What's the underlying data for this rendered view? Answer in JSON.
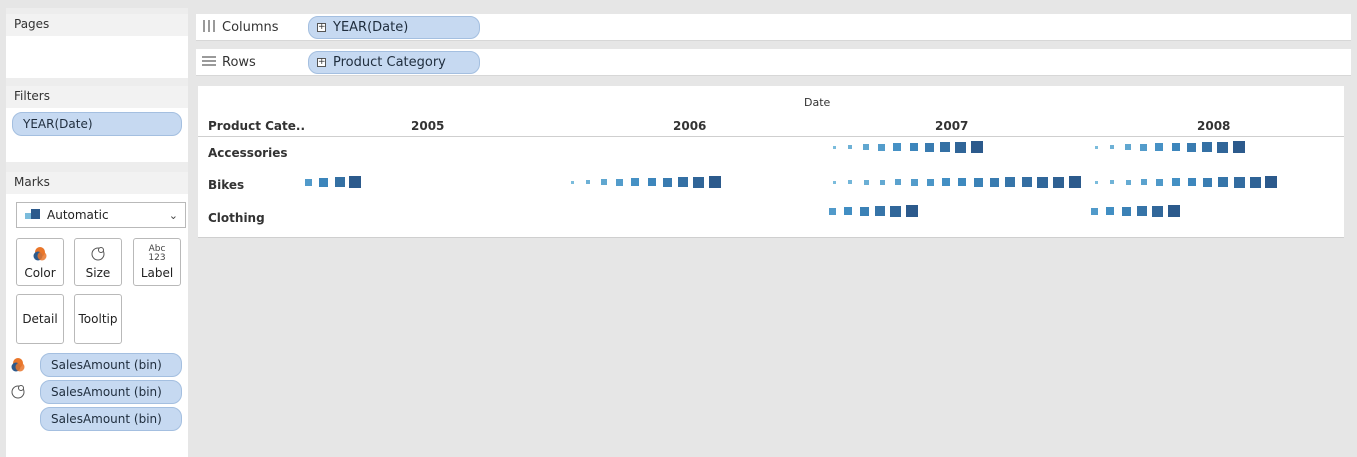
{
  "panels": {
    "pages": {
      "title": "Pages"
    },
    "filters": {
      "title": "Filters",
      "items": [
        "YEAR(Date)"
      ]
    },
    "marks": {
      "title": "Marks",
      "mark_type": "Automatic",
      "buttons": [
        {
          "label": "Color",
          "icon": "color-icon"
        },
        {
          "label": "Size",
          "icon": "size-icon"
        },
        {
          "label": "Label",
          "icon": "label-icon",
          "icon_text": "Abc\n123"
        },
        {
          "label": "Detail"
        },
        {
          "label": "Tooltip"
        }
      ],
      "fields": [
        {
          "label": "SalesAmount (bin)",
          "icon": "color-icon"
        },
        {
          "label": "SalesAmount (bin)",
          "icon": "size-icon"
        },
        {
          "label": "SalesAmount (bin)",
          "icon": ""
        }
      ]
    }
  },
  "shelves": {
    "columns": {
      "label": "Columns",
      "pill": "YEAR(Date)"
    },
    "rows": {
      "label": "Rows",
      "pill": "Product Category"
    }
  },
  "view": {
    "column_header_title": "Date",
    "row_header_title": "Product Cate..",
    "columns": [
      "2005",
      "2006",
      "2007",
      "2008"
    ],
    "rows": [
      "Accessories",
      "Bikes",
      "Clothing"
    ]
  },
  "chart_data": {
    "type": "table",
    "title": "",
    "xlabel": "Date",
    "ylabel": "Product Category",
    "categories": [
      "2005",
      "2006",
      "2007",
      "2008"
    ],
    "series": [
      {
        "name": "Accessories",
        "values": [
          0,
          0,
          10,
          10
        ]
      },
      {
        "name": "Bikes",
        "values": [
          4,
          10,
          16,
          12
        ]
      },
      {
        "name": "Clothing",
        "values": [
          0,
          0,
          6,
          6
        ]
      }
    ]
  },
  "colors": {
    "light": "#7bbcdc",
    "mid": "#3f8cc2",
    "dark": "#2c5a8c",
    "pill": "#c6d9f1"
  }
}
